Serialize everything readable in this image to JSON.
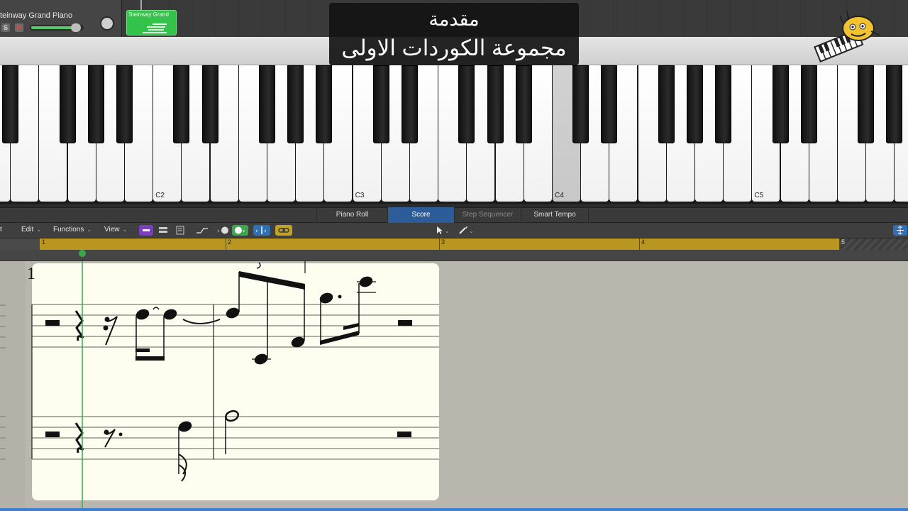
{
  "track": {
    "name": "Steinway Grand Piano",
    "name_visible": "teinway Grand Piano",
    "solo": "S",
    "record": "R",
    "region_name": "Steinway Grand"
  },
  "overlay": {
    "line1": "مقدمة",
    "line2": "مجموعة الكوردات الاولى"
  },
  "keyboard": {
    "labels": [
      "C2",
      "C3",
      "C4",
      "C5"
    ],
    "pressed_key": "C4 (adjacent)"
  },
  "editor_tabs": [
    "Piano Roll",
    "Score",
    "Step Sequencer",
    "Smart Tempo"
  ],
  "active_tab": "Score",
  "toolbar": {
    "edge_menu": "t",
    "edit": "Edit",
    "functions": "Functions",
    "view": "View"
  },
  "ruler": {
    "bars": [
      "1",
      "2",
      "3",
      "4",
      "5"
    ]
  },
  "score": {
    "bar_number": "1"
  },
  "colors": {
    "region_green": "#34c34a",
    "ruler_gold": "#b8961f",
    "active_tab_blue": "#2c5d98",
    "score_paper": "#fdfdf0",
    "playhead_green": "#3aa84a"
  }
}
